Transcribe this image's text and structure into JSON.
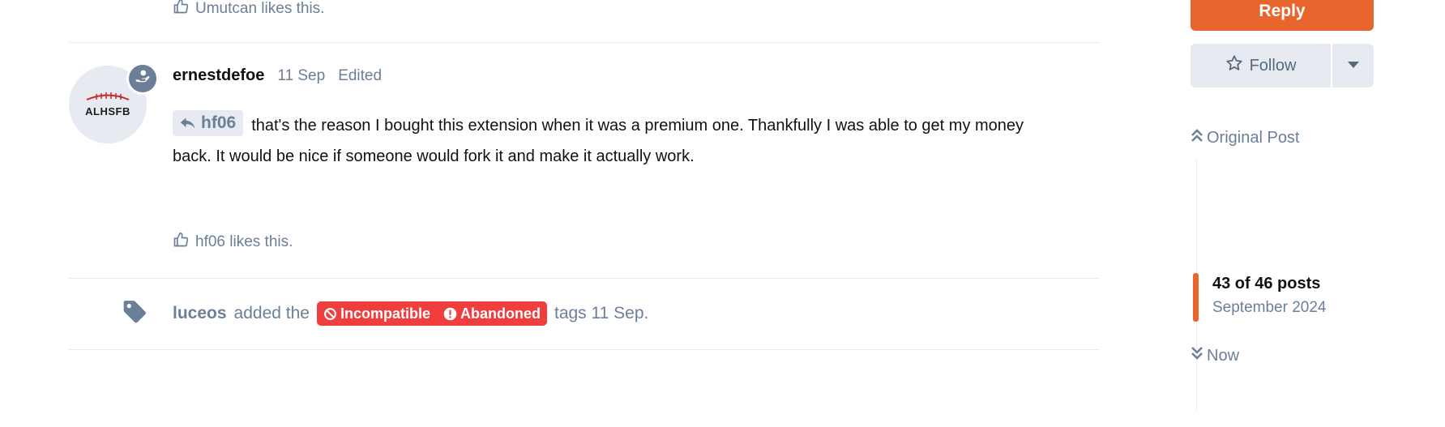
{
  "previous_post": {
    "like_text": "Umutcan likes this."
  },
  "post": {
    "avatar_text": "ALHSFB",
    "username": "ernestdefoe",
    "date": "11 Sep",
    "edited_label": "Edited",
    "mention": "hf06",
    "body_line1": "that's the reason I bought this extension when it was a premium one. Thankfully I was able to get my money",
    "body_line2": "back. It would be nice if someone would fork it and make it actually work.",
    "like_text": "hf06 likes this."
  },
  "event": {
    "user": "luceos",
    "action_text": "added the",
    "tags": [
      {
        "label": "Incompatible",
        "icon": "ban-icon"
      },
      {
        "label": "Abandoned",
        "icon": "exclamation-circle-icon"
      }
    ],
    "suffix": "tags 11 Sep."
  },
  "sidebar": {
    "reply_label": "Reply",
    "follow_label": "Follow",
    "original_post_label": "Original Post",
    "timeline_count": "43 of 46 posts",
    "timeline_date": "September 2024",
    "now_label": "Now"
  },
  "colors": {
    "accent": "#e8662e",
    "tag_red": "#f03d3d",
    "muted": "#6b7f99",
    "button_bg": "#e7ebf1"
  }
}
